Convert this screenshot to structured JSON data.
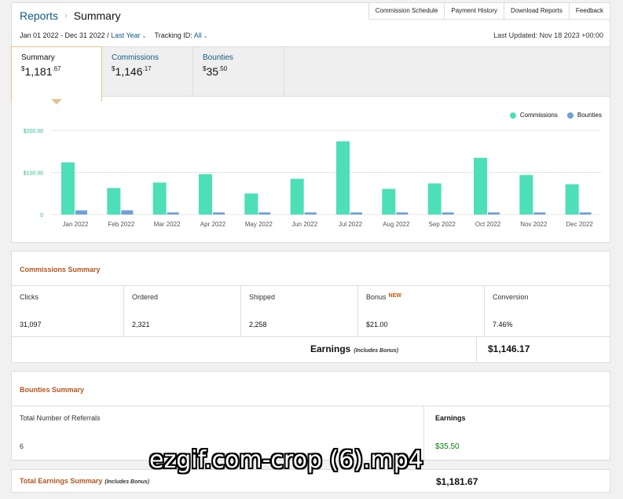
{
  "breadcrumb": {
    "parent": "Reports",
    "separator": "›",
    "current": "Summary"
  },
  "top_buttons": [
    "Commission Schedule",
    "Payment History",
    "Download Reports",
    "Feedback"
  ],
  "filters": {
    "date_range": "Jan 01 2022 - Dec 31 2022 /",
    "date_preset": "Last Year",
    "tracking_label": "Tracking ID:",
    "tracking_value": "All"
  },
  "last_updated": "Last Updated: Nov 18 2023 +00:00",
  "tabs": [
    {
      "label": "Summary",
      "currency": "$",
      "whole": "1,181",
      "cents": ".67"
    },
    {
      "label": "Commissions",
      "currency": "$",
      "whole": "1,146",
      "cents": ".17"
    },
    {
      "label": "Bounties",
      "currency": "$",
      "whole": "35",
      "cents": ".50"
    }
  ],
  "colors": {
    "commissions": "#4ddfb7",
    "bounties": "#6fa0d8",
    "accent_orange": "#b3541e",
    "link_blue": "#0f5c82",
    "green": "#067d06"
  },
  "chart_data": {
    "type": "bar",
    "categories": [
      "Jan 2022",
      "Feb 2022",
      "Mar 2022",
      "Apr 2022",
      "May 2022",
      "Jun 2022",
      "Jul 2022",
      "Aug 2022",
      "Sep 2022",
      "Oct 2022",
      "Nov 2022",
      "Dec 2022"
    ],
    "series": [
      {
        "name": "Commissions",
        "values": [
          124,
          63,
          76,
          96,
          50,
          85,
          174,
          61,
          74,
          135,
          94,
          72
        ]
      },
      {
        "name": "Bounties",
        "values": [
          10,
          10,
          5,
          5,
          5,
          5,
          5,
          5,
          5,
          5,
          5,
          5
        ]
      }
    ],
    "yticks": [
      "0",
      "$100.00",
      "$200.00"
    ],
    "ylim": [
      0,
      200
    ],
    "grid": true,
    "legend": "top-right"
  },
  "commissions_summary": {
    "title": "Commissions Summary",
    "stats": [
      {
        "label": "Clicks",
        "value": "31,097",
        "badge": ""
      },
      {
        "label": "Ordered",
        "value": "2,321",
        "badge": ""
      },
      {
        "label": "Shipped",
        "value": "2,258",
        "badge": ""
      },
      {
        "label": "Bonus",
        "value": "$21.00",
        "badge": "NEW"
      },
      {
        "label": "Conversion",
        "value": "7.46%",
        "badge": ""
      }
    ],
    "earnings_label": "Earnings",
    "earnings_note": "(Includes Bonus)",
    "earnings_value": "$1,146.17"
  },
  "bounties_summary": {
    "title": "Bounties Summary",
    "referrals_label": "Total Number of Referrals",
    "referrals_value": "6",
    "earnings_label": "Earnings",
    "earnings_value": "$35.50"
  },
  "total_summary": {
    "label": "Total Earnings Summary",
    "note": "(Includes Bonus)",
    "value": "$1,181.67"
  },
  "watermark": "ezgif.com-crop (6).mp4"
}
